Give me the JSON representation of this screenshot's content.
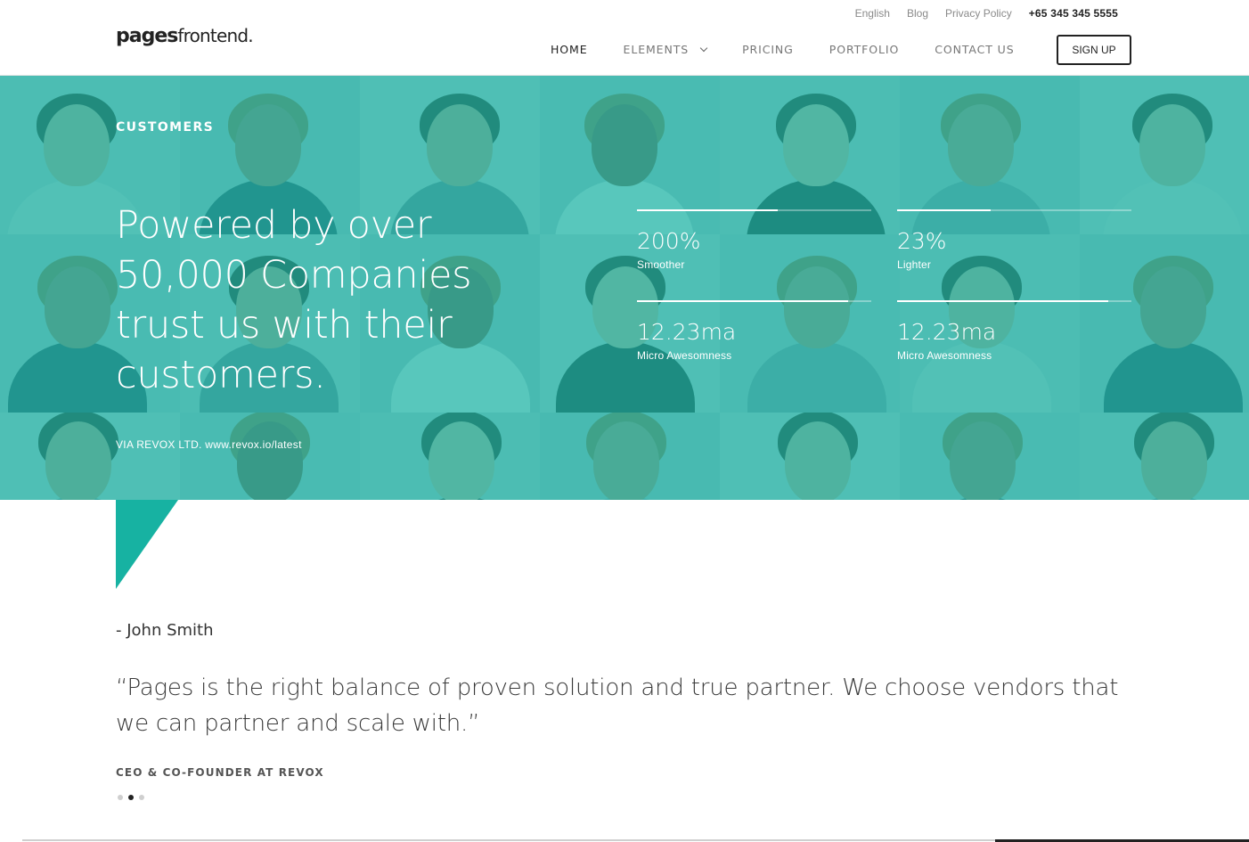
{
  "header": {
    "logo_bold": "pages",
    "logo_light": "frontend.",
    "topbar": {
      "language": "English",
      "blog": "Blog",
      "privacy": "Privacy Policy",
      "phone": "+65 345 345 5555"
    },
    "nav": [
      {
        "label": "HOME",
        "active": true
      },
      {
        "label": "ELEMENTS",
        "has_dropdown": true,
        "icon": "chevron-down-icon"
      },
      {
        "label": "PRICING"
      },
      {
        "label": "PORTFOLIO"
      },
      {
        "label": "CONTACT US"
      }
    ],
    "signup_label": "SIGN UP"
  },
  "hero": {
    "label": "CUSTOMERS",
    "title": "Powered by over 50,000 Companies trust us with their customers.",
    "via": "VIA REVOX LTD. www.revox.io/latest",
    "overlay_color": "#17b2a2",
    "stats": [
      {
        "value": "200%",
        "label": "Smoother",
        "progress": 0.6
      },
      {
        "value": "23%",
        "label": "Lighter",
        "progress": 0.4
      },
      {
        "value": "12.23ma",
        "label": "Micro Awesomness",
        "progress": 0.9
      },
      {
        "value": "12.23ma",
        "label": "Micro Awesomness",
        "progress": 0.9
      }
    ]
  },
  "testimonial": {
    "author": "- John Smith",
    "quote": "“Pages is the right balance of proven solution and true partner. We choose vendors that we can partner and scale with.”",
    "role": "CEO & CO-FOUNDER AT REVOX",
    "slides": 3,
    "active_slide": 1,
    "accent_color": "#17b2a2"
  }
}
